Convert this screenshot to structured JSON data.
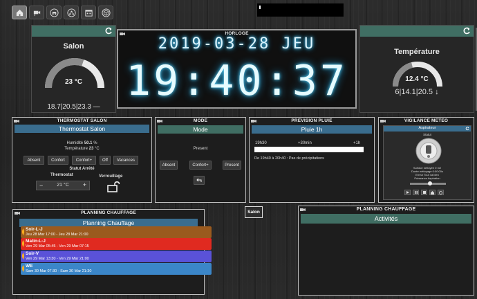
{
  "nav": {
    "items": [
      {
        "icon": "home-icon",
        "active": true
      },
      {
        "icon": "camera-icon",
        "active": false
      },
      {
        "icon": "car-icon",
        "active": false
      },
      {
        "icon": "network-icon",
        "active": false
      },
      {
        "icon": "calendar-icon",
        "active": false
      },
      {
        "icon": "cube-icon",
        "active": false
      }
    ]
  },
  "salon": {
    "title": "Salon",
    "value": "23 °C",
    "level": 0.6,
    "info": "18.7|20.5|23.3 —"
  },
  "clock": {
    "title": "HORLOGE",
    "date": "2019-03-28 JEU",
    "time": "19:40:37"
  },
  "temperature": {
    "title": "Température",
    "value": "12.4 °C",
    "level": 0.42,
    "info": "6|14.1|20.5 ↓"
  },
  "thermostat": {
    "title": "THERMOSTAT SALON",
    "header": "Thermostat Salon",
    "humidity_label": "Humidité",
    "humidity_value": "50.1",
    "humidity_unit": "%",
    "temp_label": "Température",
    "temp_value": "23",
    "temp_unit": "°C",
    "buttons": [
      "Absent",
      "Confort",
      "Confort+",
      "Off",
      "Vacances"
    ],
    "status_label": "Statut",
    "status_value": "Arrêté",
    "thermostat_label": "Thermostat",
    "setpoint": "21 °C",
    "minus": "−",
    "plus": "+",
    "lock_label": "Verrouillage"
  },
  "mode": {
    "title": "MODE",
    "header": "Mode",
    "current": "Present",
    "buttons": [
      "Absent",
      "Confort+",
      "Present"
    ]
  },
  "rain": {
    "title": "PREVISION PLUIE",
    "header": "Pluie 1h",
    "t0": "19h30",
    "t1": "+30min",
    "t2": "+1h",
    "note": "De 19h40 à 20h40 : Pas de précipitations"
  },
  "vigilance": {
    "title": "VIGILANCE METEO",
    "header": "Aspirateur",
    "status": "Statut",
    "lines": [
      "Surface nettoyée 0 m2",
      "Durée nettoyage 0:00:00s",
      "Erreur Tout va bien",
      "Puissance Aspiration"
    ]
  },
  "planning": {
    "title": "PLANNING CHAUFFAGE",
    "header": "Planning Chauffage",
    "entries": [
      {
        "name": "Soir-L-J",
        "dates": "Jeu 28 Mar 17:00 - Jeu 28 Mar 21:00",
        "color": "#9a5a1e"
      },
      {
        "name": "Matin-L-J",
        "dates": "Ven 29 Mar 05:45 - Ven 29 Mar 07:15",
        "color": "#e02a20"
      },
      {
        "name": "Soir-V",
        "dates": "Ven 29 Mar 13:30 - Ven 29 Mar 21:00",
        "color": "#5a52d8"
      },
      {
        "name": "WE",
        "dates": "Sam 30 Mar 07:30 - Sam 30 Mar 21:30",
        "color": "#3b86c8"
      }
    ]
  },
  "salon_button": "Salon",
  "planning2": {
    "title": "PLANNING CHAUFFAGE",
    "header": "Activités"
  }
}
